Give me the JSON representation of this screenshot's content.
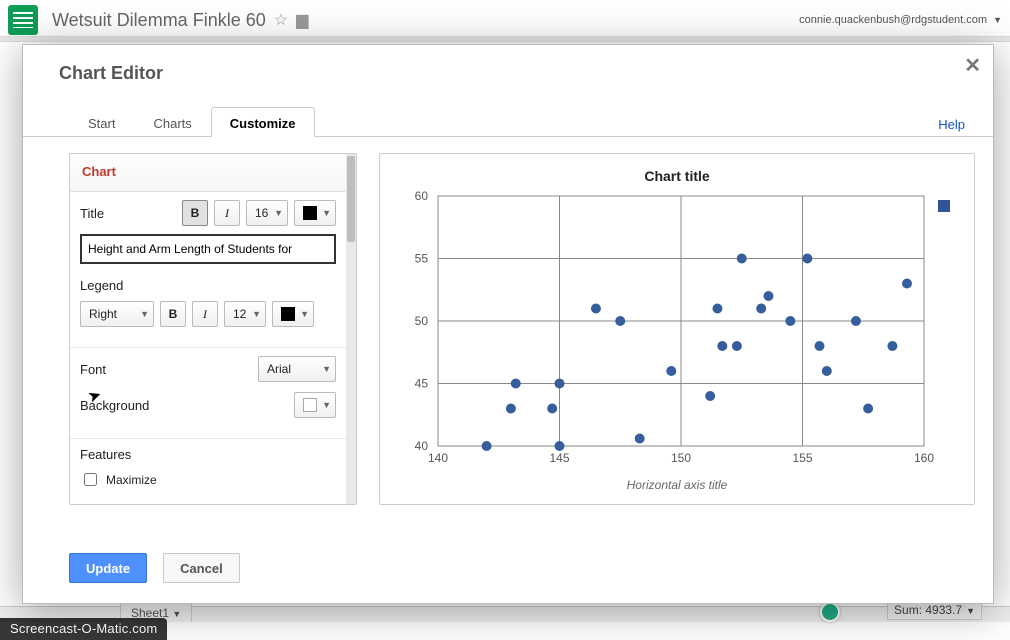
{
  "doc_title": "Wetsuit Dilemma Finkle 60",
  "user_email": "connie.quackenbush@rdgstudent.com",
  "modal_title": "Chart Editor",
  "help_label": "Help",
  "tabs": {
    "start": "Start",
    "charts": "Charts",
    "customize": "Customize"
  },
  "sections": {
    "chart_head": "Chart",
    "title_label": "Title",
    "title_fontsize": "16",
    "title_input": "Height and Arm Length of Students for ",
    "legend_label": "Legend",
    "legend_position": "Right",
    "legend_fontsize": "12",
    "font_label": "Font",
    "font_value": "Arial",
    "bg_label": "Background",
    "features_label": "Features",
    "maximize_label": "Maximize"
  },
  "buttons": {
    "update": "Update",
    "cancel": "Cancel"
  },
  "status": {
    "sum_label": "Sum: 4933.7",
    "sheet_tab": "Sheet1"
  },
  "screencast": "Screencast-O-Matic.com",
  "chart_data": {
    "type": "scatter",
    "title": "Chart title",
    "xlabel": "Horizontal axis title",
    "ylabel": "",
    "xlim": [
      140,
      160
    ],
    "ylim": [
      40,
      60
    ],
    "xticks": [
      140,
      145,
      150,
      155,
      160
    ],
    "yticks": [
      40,
      45,
      50,
      55,
      60
    ],
    "series": [
      {
        "name": "",
        "points": [
          [
            142,
            40
          ],
          [
            143,
            43
          ],
          [
            143.2,
            45
          ],
          [
            144.7,
            43
          ],
          [
            145,
            40
          ],
          [
            145,
            45
          ],
          [
            146.5,
            51
          ],
          [
            147.5,
            50
          ],
          [
            148.3,
            40.6
          ],
          [
            149.6,
            46
          ],
          [
            151.2,
            44
          ],
          [
            151.7,
            48
          ],
          [
            151.5,
            51
          ],
          [
            152.3,
            48
          ],
          [
            152.5,
            55
          ],
          [
            153.3,
            51
          ],
          [
            153.6,
            52
          ],
          [
            154.5,
            50
          ],
          [
            155.2,
            55
          ],
          [
            155.7,
            48
          ],
          [
            156,
            46
          ],
          [
            157.2,
            50
          ],
          [
            157.7,
            43
          ],
          [
            158.7,
            48
          ],
          [
            159.3,
            53
          ]
        ]
      }
    ]
  }
}
